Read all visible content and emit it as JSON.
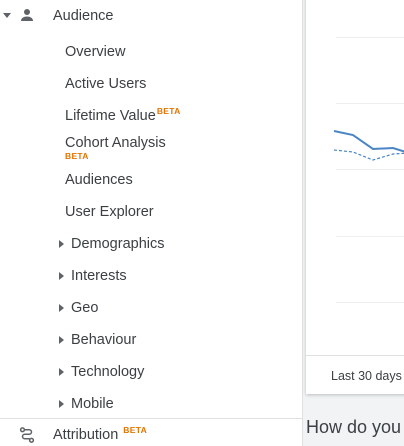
{
  "sidebar": {
    "section": {
      "label": "Audience",
      "icon": "person-icon"
    },
    "items": [
      {
        "label": "Overview"
      },
      {
        "label": "Active Users"
      },
      {
        "label": "Lifetime Value",
        "badge": "BETA"
      },
      {
        "label": "Cohort Analysis",
        "badge": "BETA"
      },
      {
        "label": "Audiences"
      },
      {
        "label": "User Explorer"
      }
    ],
    "expandable": [
      {
        "label": "Demographics"
      },
      {
        "label": "Interests"
      },
      {
        "label": "Geo"
      },
      {
        "label": "Behaviour"
      },
      {
        "label": "Technology"
      },
      {
        "label": "Mobile"
      }
    ],
    "attribution": {
      "label": "Attribution",
      "badge": "BETA",
      "icon": "attribution-icon"
    }
  },
  "main": {
    "date_range": "Last 30 days",
    "question": "How do you"
  },
  "colors": {
    "beta": "#e37400",
    "line": "#4a86c5"
  }
}
